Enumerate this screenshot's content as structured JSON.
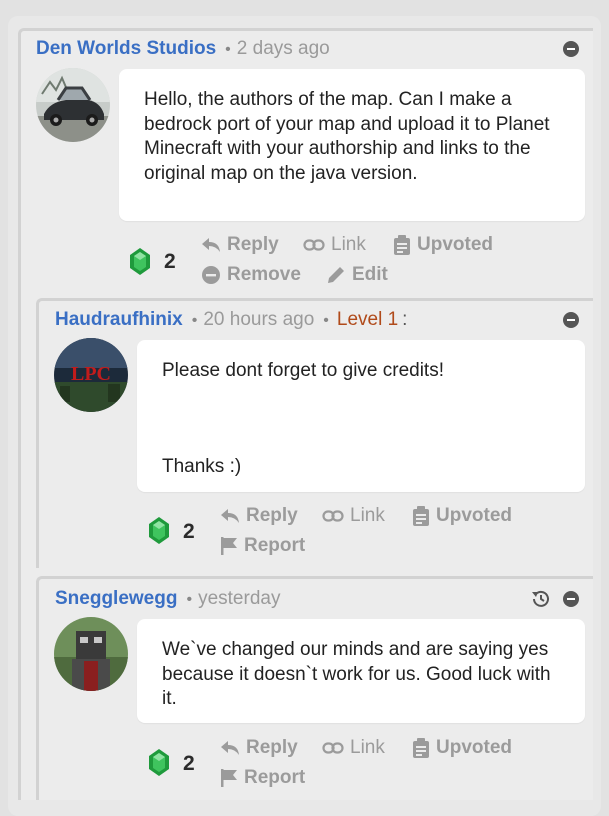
{
  "comments": [
    {
      "author": "Den Worlds Studios",
      "time": "2 days ago",
      "body": "Hello, the authors of the map. Can I make a bedrock port of your map and upload it to Planet Minecraft with your authorship and links to the original map on the java version.",
      "score": "2",
      "actions": {
        "reply": "Reply",
        "link": "Link",
        "upvoted": "Upvoted",
        "remove": "Remove",
        "edit": "Edit"
      }
    },
    {
      "author": "Haudraufhinix",
      "time": "20 hours ago",
      "level": "Level 1",
      "colon": ":",
      "body_line1": "Please dont forget to give credits!",
      "body_line2": "Thanks :)",
      "score": "2",
      "actions": {
        "reply": "Reply",
        "link": "Link",
        "upvoted": "Upvoted",
        "report": "Report"
      }
    },
    {
      "author": "Snegglewegg",
      "time": "yesterday",
      "body": "We`ve changed our minds and are saying yes because it doesn`t work for us. Good luck with it.",
      "score": "2",
      "actions": {
        "reply": "Reply",
        "link": "Link",
        "upvoted": "Upvoted",
        "report": "Report"
      }
    }
  ],
  "colors": {
    "author": "#3a6fc4",
    "level": "#b04a1a",
    "gem": "#2faa4a",
    "muted": "#9b9b9b"
  },
  "icons": [
    "collapse-icon",
    "history-icon",
    "emerald-icon",
    "reply-icon",
    "link-icon",
    "clipboard-icon",
    "remove-icon",
    "pencil-icon",
    "flag-icon"
  ]
}
